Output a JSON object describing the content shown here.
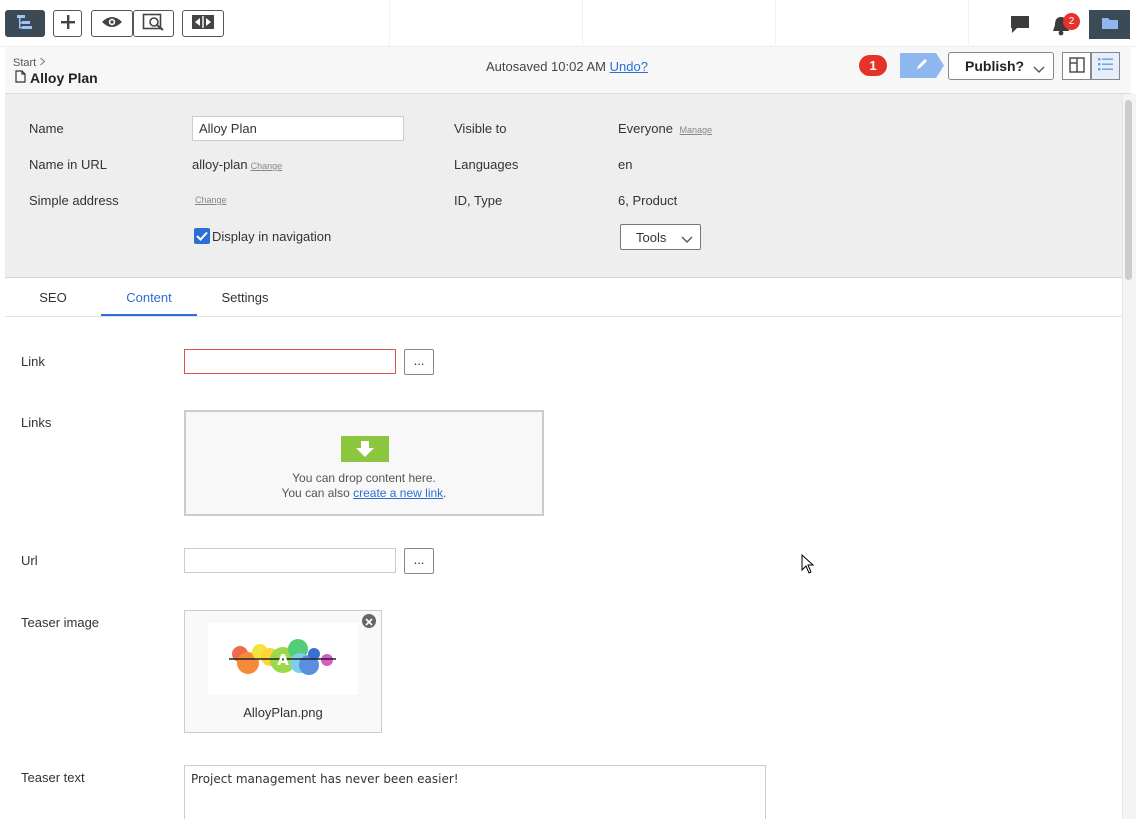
{
  "toolbar": {
    "buttons": [
      {
        "name": "page-tree",
        "icon": "tree-icon"
      },
      {
        "name": "add",
        "icon": "plus-icon"
      },
      {
        "name": "preview",
        "icon": "eye-icon"
      },
      {
        "name": "view-search",
        "icon": "search-page-icon"
      },
      {
        "name": "compare",
        "icon": "compare-icon"
      }
    ],
    "right_icons": [
      "comment-icon",
      "bell-icon",
      "folder-icon"
    ],
    "notification_count": "2"
  },
  "header": {
    "breadcrumb": "Start",
    "title": "Alloy Plan",
    "autosave_text": "Autosaved 10:02 AM",
    "undo_label": "Undo?",
    "change_count": "1",
    "publish_label": "Publish?",
    "accent_color": "#2b6fd6",
    "alert_color": "#e5332a"
  },
  "properties": {
    "name_label": "Name",
    "name_value": "Alloy Plan",
    "url_label": "Name in URL",
    "url_value": "alloy-plan",
    "url_change": "Change",
    "simple_address_label": "Simple address",
    "simple_address_change": "Change",
    "display_in_nav_label": "Display in navigation",
    "display_in_nav_checked": true,
    "visible_to_label": "Visible to",
    "visible_to_value": "Everyone",
    "visible_to_manage": "Manage",
    "languages_label": "Languages",
    "languages_value": "en",
    "id_type_label": "ID, Type",
    "id_type_value": "6, Product",
    "tools_label": "Tools"
  },
  "tabs": [
    {
      "label": "SEO",
      "active": false
    },
    {
      "label": "Content",
      "active": true
    },
    {
      "label": "Settings",
      "active": false
    }
  ],
  "content": {
    "link_label": "Link",
    "link_value": "",
    "browse_label": "...",
    "links_label": "Links",
    "drop_text": "You can drop content here.",
    "drop_text2_prefix": "You can also ",
    "drop_link": "create a new link",
    "drop_text2_suffix": ".",
    "url_label": "Url",
    "url_value": "",
    "teaser_image_label": "Teaser image",
    "teaser_image_filename": "AlloyPlan.png",
    "teaser_image_logo_letter": "A",
    "teaser_text_label": "Teaser text",
    "teaser_text_value": "Project management has never been easier!"
  }
}
